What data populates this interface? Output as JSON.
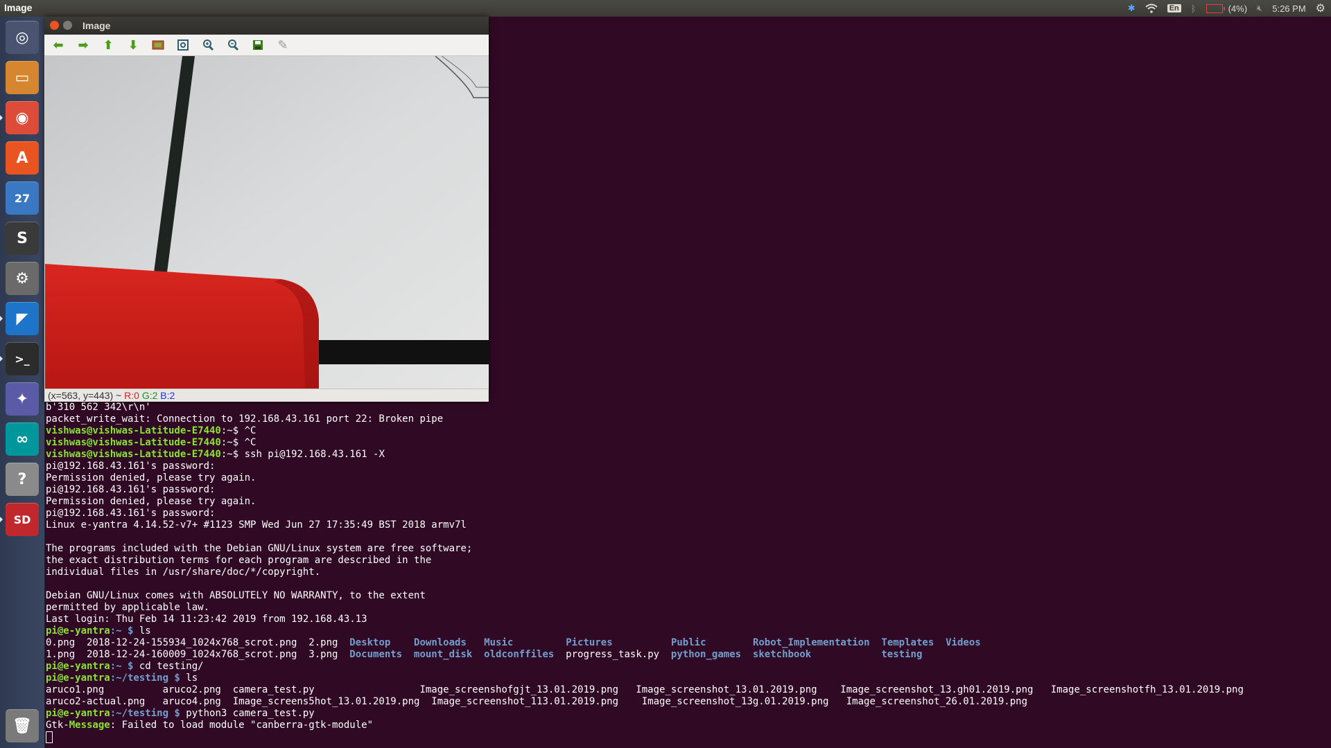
{
  "topbar": {
    "app_title": "Image",
    "language": "En",
    "battery": "(4%)",
    "time": "5:26 PM",
    "icons": [
      "bluetooth-disabled-icon",
      "wifi-icon",
      "keyboard-language-icon",
      "bluetooth-icon",
      "battery-icon",
      "volume-muted-icon",
      "gear-icon"
    ]
  },
  "launcher": {
    "items": [
      {
        "name": "dash-home",
        "icon": "ubuntu-logo-icon"
      },
      {
        "name": "files",
        "icon": "file-cabinet-icon"
      },
      {
        "name": "chrome",
        "icon": "chrome-icon"
      },
      {
        "name": "software-center",
        "icon": "software-center-icon"
      },
      {
        "name": "calendar",
        "icon": "calendar-icon",
        "label": "27"
      },
      {
        "name": "sublime-text",
        "icon": "sublime-icon",
        "label": "S"
      },
      {
        "name": "system-settings",
        "icon": "settings-icon"
      },
      {
        "name": "vscode",
        "icon": "vscode-icon"
      },
      {
        "name": "terminal",
        "icon": "terminal-icon",
        "label": ">_"
      },
      {
        "name": "unity-tweak",
        "icon": "tweak-icon"
      },
      {
        "name": "arduino",
        "icon": "arduino-icon",
        "label": "∞"
      },
      {
        "name": "help",
        "icon": "help-icon",
        "label": "?"
      },
      {
        "name": "sd-card-formatter",
        "icon": "sd-card-icon",
        "label": "SD"
      },
      {
        "name": "trash",
        "icon": "trash-icon"
      }
    ],
    "colors": {
      "files": "#d5862f",
      "chrome": "#dd4b39",
      "software-center": "#e95420",
      "calendar": "#3a78c3",
      "sublime-text": "#3a3a3a",
      "system-settings": "#6a6a6a",
      "vscode": "#1e74c8",
      "terminal": "#2c2c2c",
      "unity-tweak": "#5b5aa6",
      "arduino": "#00979c",
      "help": "#8a8a8a",
      "sd-card-formatter": "#c0282d",
      "trash": "#7a7a7a",
      "dash-home": "#4a5470"
    }
  },
  "image_window": {
    "title": "Image",
    "toolbar": [
      "back-arrow-icon",
      "forward-arrow-icon",
      "up-arrow-icon",
      "down-arrow-icon",
      "save-image-icon",
      "zoom-fit-icon",
      "zoom-in-icon",
      "zoom-out-icon",
      "save-icon",
      "properties-icon"
    ],
    "status": {
      "coords": "(x=563, y=443) ~ ",
      "r": "R:0",
      "g": "G:2",
      "b": "B:2"
    }
  },
  "terminal": {
    "lines": [
      {
        "parts": [
          {
            "t": "b'310 562 342\\r\\n'",
            "c": "normal"
          }
        ]
      },
      {
        "parts": [
          {
            "t": "packet_write_wait: Connection to 192.168.43.161 port 22: Broken pipe",
            "c": "normal"
          }
        ]
      },
      {
        "parts": [
          {
            "t": "vishwas@vishwas-Latitude-E7440",
            "c": "prompt"
          },
          {
            "t": ":~$ ^C",
            "c": "normal"
          }
        ]
      },
      {
        "parts": [
          {
            "t": "vishwas@vishwas-Latitude-E7440",
            "c": "prompt"
          },
          {
            "t": ":~$ ^C",
            "c": "normal"
          }
        ]
      },
      {
        "parts": [
          {
            "t": "vishwas@vishwas-Latitude-E7440",
            "c": "prompt"
          },
          {
            "t": ":~$ ssh pi@192.168.43.161 -X",
            "c": "normal"
          }
        ]
      },
      {
        "parts": [
          {
            "t": "pi@192.168.43.161's password:",
            "c": "normal"
          }
        ]
      },
      {
        "parts": [
          {
            "t": "Permission denied, please try again.",
            "c": "normal"
          }
        ]
      },
      {
        "parts": [
          {
            "t": "pi@192.168.43.161's password:",
            "c": "normal"
          }
        ]
      },
      {
        "parts": [
          {
            "t": "Permission denied, please try again.",
            "c": "normal"
          }
        ]
      },
      {
        "parts": [
          {
            "t": "pi@192.168.43.161's password:",
            "c": "normal"
          }
        ]
      },
      {
        "parts": [
          {
            "t": "Linux e-yantra 4.14.52-v7+ #1123 SMP Wed Jun 27 17:35:49 BST 2018 armv7l",
            "c": "normal"
          }
        ]
      },
      {
        "parts": [
          {
            "t": "",
            "c": "normal"
          }
        ]
      },
      {
        "parts": [
          {
            "t": "The programs included with the Debian GNU/Linux system are free software;",
            "c": "normal"
          }
        ]
      },
      {
        "parts": [
          {
            "t": "the exact distribution terms for each program are described in the",
            "c": "normal"
          }
        ]
      },
      {
        "parts": [
          {
            "t": "individual files in /usr/share/doc/*/copyright.",
            "c": "normal"
          }
        ]
      },
      {
        "parts": [
          {
            "t": "",
            "c": "normal"
          }
        ]
      },
      {
        "parts": [
          {
            "t": "Debian GNU/Linux comes with ABSOLUTELY NO WARRANTY, to the extent",
            "c": "normal"
          }
        ]
      },
      {
        "parts": [
          {
            "t": "permitted by applicable law.",
            "c": "normal"
          }
        ]
      },
      {
        "parts": [
          {
            "t": "Last login: Thu Feb 14 11:23:42 2019 from 192.168.43.13",
            "c": "normal"
          }
        ]
      },
      {
        "parts": [
          {
            "t": "pi@e-yantra",
            "c": "prompt"
          },
          {
            "t": ":~ $ ",
            "c": "blue"
          },
          {
            "t": "ls",
            "c": "normal"
          }
        ]
      },
      {
        "parts": [
          {
            "t": "0.png  2018-12-24-155934_1024x768_scrot.png  2.png  ",
            "c": "normal"
          },
          {
            "t": "Desktop",
            "c": "blue"
          },
          {
            "t": "    ",
            "c": "normal"
          },
          {
            "t": "Downloads",
            "c": "blue"
          },
          {
            "t": "   ",
            "c": "normal"
          },
          {
            "t": "Music",
            "c": "blue"
          },
          {
            "t": "         ",
            "c": "normal"
          },
          {
            "t": "Pictures",
            "c": "blue"
          },
          {
            "t": "          ",
            "c": "normal"
          },
          {
            "t": "Public",
            "c": "blue"
          },
          {
            "t": "        ",
            "c": "normal"
          },
          {
            "t": "Robot_Implementation",
            "c": "blue"
          },
          {
            "t": "  ",
            "c": "normal"
          },
          {
            "t": "Templates",
            "c": "blue"
          },
          {
            "t": "  ",
            "c": "normal"
          },
          {
            "t": "Videos",
            "c": "blue"
          }
        ]
      },
      {
        "parts": [
          {
            "t": "1.png  2018-12-24-160009_1024x768_scrot.png  3.png  ",
            "c": "normal"
          },
          {
            "t": "Documents",
            "c": "blue"
          },
          {
            "t": "  ",
            "c": "normal"
          },
          {
            "t": "mount_disk",
            "c": "blue"
          },
          {
            "t": "  ",
            "c": "normal"
          },
          {
            "t": "oldconffiles",
            "c": "blue"
          },
          {
            "t": "  progress_task.py  ",
            "c": "normal"
          },
          {
            "t": "python_games",
            "c": "blue"
          },
          {
            "t": "  ",
            "c": "normal"
          },
          {
            "t": "sketchbook",
            "c": "blue"
          },
          {
            "t": "            ",
            "c": "normal"
          },
          {
            "t": "testing",
            "c": "blue"
          }
        ]
      },
      {
        "parts": [
          {
            "t": "pi@e-yantra",
            "c": "prompt"
          },
          {
            "t": ":~ $ ",
            "c": "blue"
          },
          {
            "t": "cd testing/",
            "c": "normal"
          }
        ]
      },
      {
        "parts": [
          {
            "t": "pi@e-yantra",
            "c": "prompt"
          },
          {
            "t": ":~/testing $ ",
            "c": "blue"
          },
          {
            "t": "ls",
            "c": "normal"
          }
        ]
      },
      {
        "parts": [
          {
            "t": "aruco1.png          aruco2.png  camera_test.py                  Image_screenshofgjt_13.01.2019.png   Image_screenshot_13.01.2019.png    Image_screenshot_13.gh01.2019.png   Image_screenshotfh_13.01.2019.png",
            "c": "normal"
          }
        ]
      },
      {
        "parts": [
          {
            "t": "aruco2-actual.png   aruco4.png  Image_screens5hot_13.01.2019.png  Image_screenshot_113.01.2019.png    Image_screenshot_13g.01.2019.png   Image_screenshot_26.01.2019.png",
            "c": "normal"
          }
        ]
      },
      {
        "parts": [
          {
            "t": "pi@e-yantra",
            "c": "prompt"
          },
          {
            "t": ":~/testing $ ",
            "c": "blue"
          },
          {
            "t": "python3 camera_test.py",
            "c": "normal"
          }
        ]
      },
      {
        "parts": [
          {
            "t": "Gtk-",
            "c": "normal"
          },
          {
            "t": "Message",
            "c": "prompt"
          },
          {
            "t": ": Failed to load module \"canberra-gtk-module\"",
            "c": "normal"
          }
        ]
      }
    ]
  }
}
